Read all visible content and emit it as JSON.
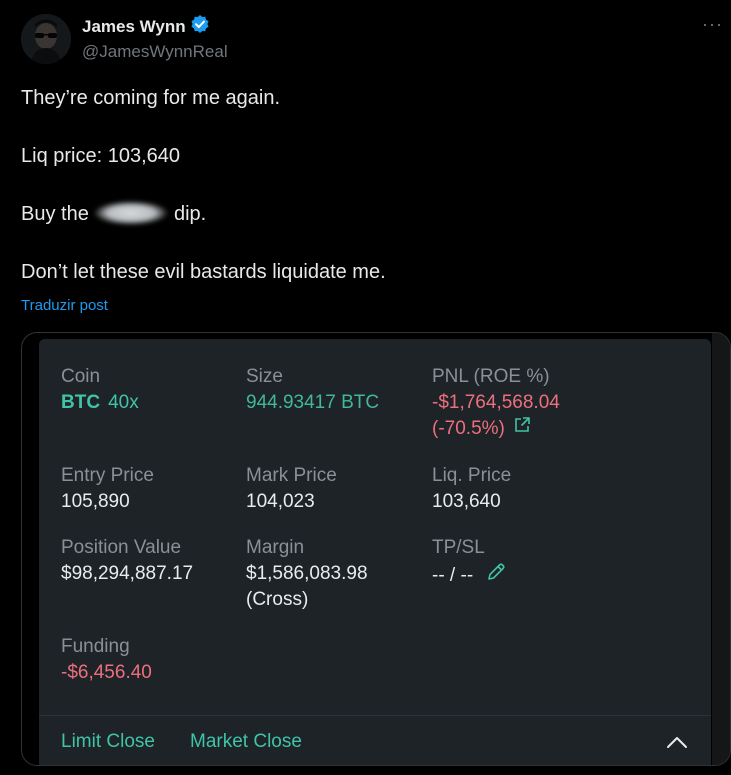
{
  "post": {
    "author_name": "James Wynn",
    "author_handle": "@JamesWynnReal",
    "more_label": "···",
    "lines": [
      "They’re coming for me again.",
      "Liq price: 103,640",
      "Buy the",
      "dip.",
      "Don’t let these evil bastards liquidate me."
    ],
    "translate_label": "Traduzir post"
  },
  "position_card": {
    "coin_label": "Coin",
    "coin": "BTC",
    "leverage": "40x",
    "size_label": "Size",
    "size": "944.93417 BTC",
    "pnl_label": "PNL (ROE %)",
    "pnl": "-$1,764,568.04",
    "roe": "(-70.5%)",
    "entry_label": "Entry Price",
    "entry": "105,890",
    "mark_label": "Mark Price",
    "mark": "104,023",
    "liq_label": "Liq. Price",
    "liq": "103,640",
    "position_value_label": "Position Value",
    "position_value": "$98,294,887.17",
    "margin_label": "Margin",
    "margin": "$1,586,083.98",
    "margin_mode": "(Cross)",
    "tpsl_label": "TP/SL",
    "tpsl": "-- / --",
    "funding_label": "Funding",
    "funding": "-$6,456.40",
    "limit_close": "Limit Close",
    "market_close": "Market Close"
  },
  "colors": {
    "background": "#000000",
    "card": "#1e2327",
    "accent_green": "#40c3a7",
    "negative_red": "#ed6f7e",
    "link_blue": "#1d9bf0"
  }
}
